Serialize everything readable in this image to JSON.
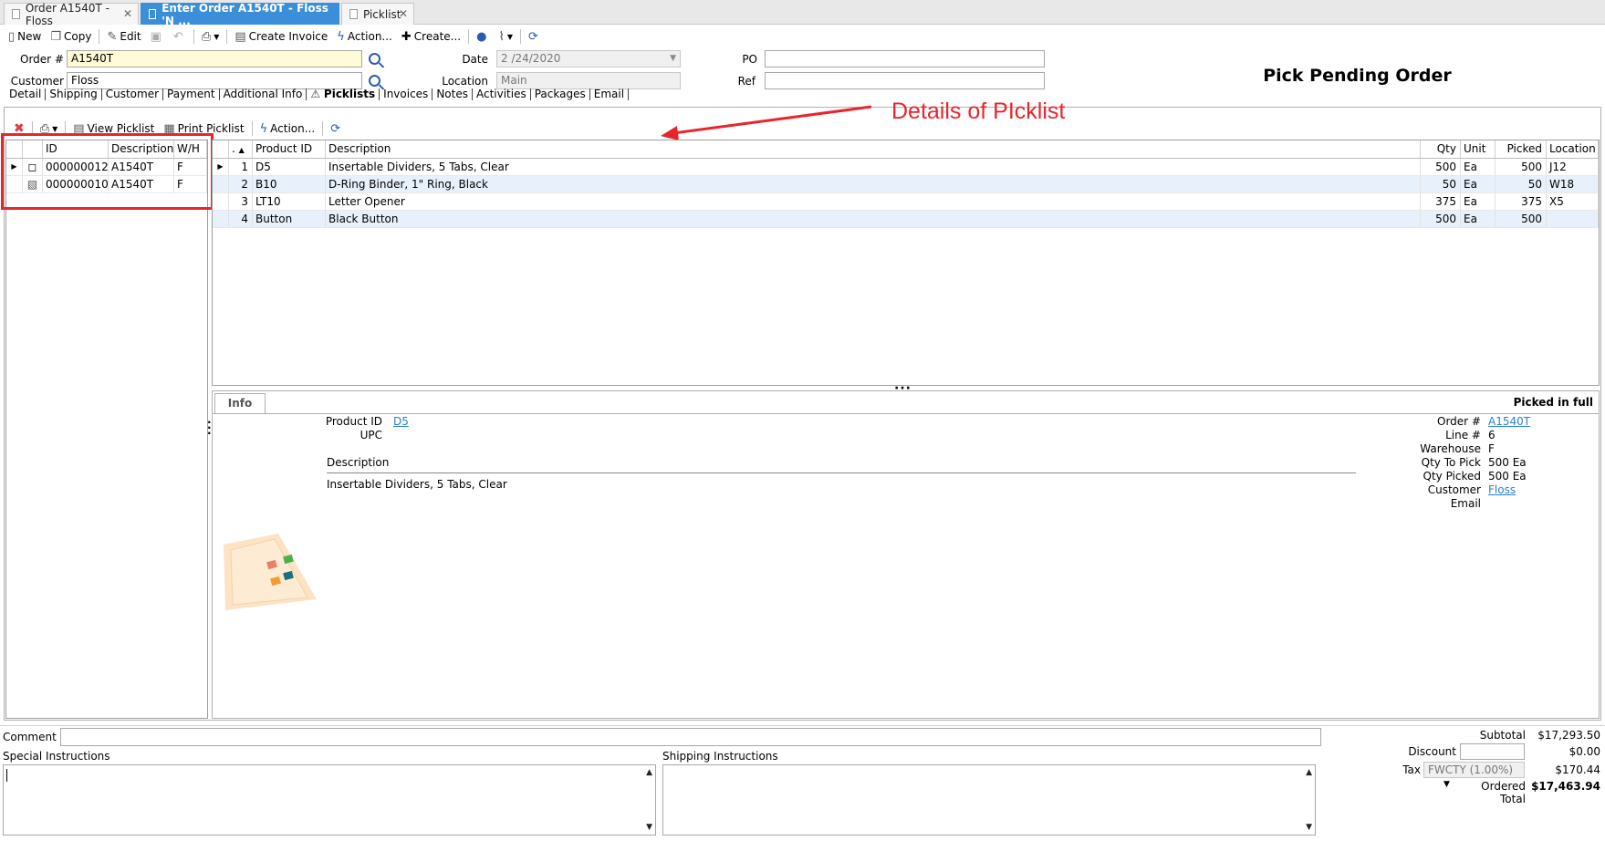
{
  "tabs": [
    {
      "label": "Order A1540T - Floss",
      "active": false
    },
    {
      "label": "Enter Order A1540T - Floss 'N ...",
      "active": true
    },
    {
      "label": "Picklist",
      "active": false
    }
  ],
  "toolbar": {
    "new": "New",
    "copy": "Copy",
    "edit": "Edit",
    "create_invoice": "Create Invoice",
    "action": "Action...",
    "create": "Create..."
  },
  "header": {
    "order_label": "Order #",
    "order_value": "A1540T",
    "customer_label": "Customer",
    "customer_value": "Floss",
    "date_label": "Date",
    "date_value": "2 /24/2020",
    "location_label": "Location",
    "location_value": "Main",
    "po_label": "PO",
    "po_value": "",
    "ref_label": "Ref",
    "ref_value": "",
    "status_title": "Pick Pending Order"
  },
  "section_tabs": [
    "Detail",
    "Shipping",
    "Customer",
    "Payment",
    "Additional Info",
    "Picklists",
    "Invoices",
    "Notes",
    "Activities",
    "Packages",
    "Email"
  ],
  "selected_section": "Picklists",
  "picklist_toolbar": {
    "view": "View Picklist",
    "print": "Print Picklist",
    "action": "Action..."
  },
  "annotation": "Details of PIcklist",
  "picklists": {
    "headers": [
      "ID",
      "Description",
      "W/H"
    ],
    "rows": [
      {
        "id": "000000012",
        "description": "A1540T",
        "wh": "F"
      },
      {
        "id": "000000010",
        "description": "A1540T",
        "wh": "F"
      }
    ]
  },
  "lines": {
    "headers": {
      "num": ".",
      "product_id": "Product ID",
      "description": "Description",
      "qty": "Qty",
      "unit": "Unit",
      "picked": "Picked",
      "location": "Location"
    },
    "rows": [
      {
        "num": "1",
        "product_id": "D5",
        "description": "Insertable Dividers, 5 Tabs, Clear",
        "qty": "500",
        "unit": "Ea",
        "picked": "500",
        "location": "J12"
      },
      {
        "num": "2",
        "product_id": "B10",
        "description": "D-Ring Binder, 1\" Ring, Black",
        "qty": "50",
        "unit": "Ea",
        "picked": "50",
        "location": "W18"
      },
      {
        "num": "3",
        "product_id": "LT10",
        "description": "Letter Opener",
        "qty": "375",
        "unit": "Ea",
        "picked": "375",
        "location": "X5"
      },
      {
        "num": "4",
        "product_id": "Button",
        "description": "Black Button",
        "qty": "500",
        "unit": "Ea",
        "picked": "500",
        "location": ""
      }
    ]
  },
  "info": {
    "tab": "Info",
    "status": "Picked in full",
    "product_id_label": "Product ID",
    "product_id_value": "D5",
    "upc_label": "UPC",
    "description_label": "Description",
    "description_value": "Insertable Dividers, 5 Tabs, Clear",
    "order_label": "Order #",
    "order_value": "A1540T",
    "line_label": "Line #",
    "line_value": "6",
    "warehouse_label": "Warehouse",
    "warehouse_value": "F",
    "qty_to_pick_label": "Qty To Pick",
    "qty_to_pick_value": "500 Ea",
    "qty_picked_label": "Qty Picked",
    "qty_picked_value": "500 Ea",
    "customer_label": "Customer",
    "customer_value": "Floss",
    "email_label": "Email"
  },
  "footer": {
    "comment_label": "Comment",
    "special_label": "Special Instructions",
    "shipping_label": "Shipping Instructions",
    "subtotal_label": "Subtotal",
    "subtotal_value": "$17,293.50",
    "discount_label": "Discount",
    "discount_value": "$0.00",
    "tax_label": "Tax",
    "tax_code": "FWCTY (1.00%)",
    "tax_value": "$170.44",
    "total_label": "Ordered Total",
    "total_value": "$17,463.94"
  },
  "colors": {
    "accent": "#3b8fd9",
    "annotation": "#e8252b",
    "highlight": "#fffbd6"
  }
}
